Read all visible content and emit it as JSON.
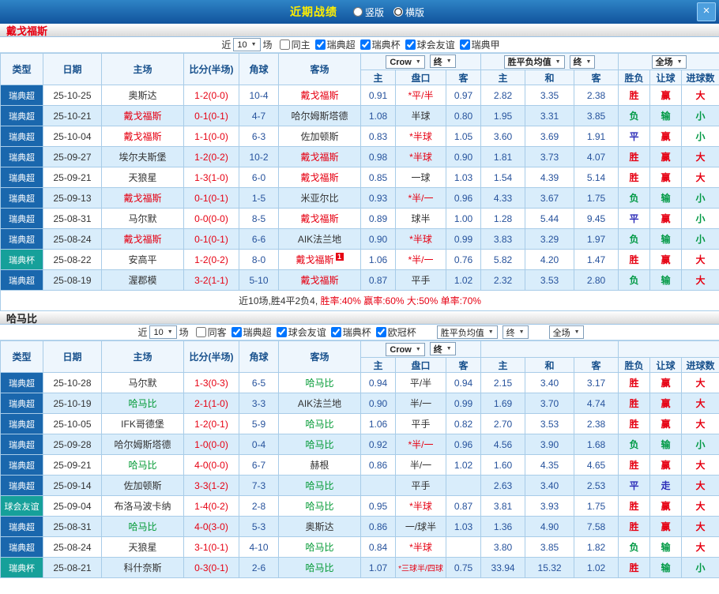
{
  "topbar": {
    "title": "近期战绩",
    "layout_options": [
      {
        "label": "竖版",
        "selected": false
      },
      {
        "label": "横版",
        "selected": true
      }
    ],
    "close_label": "×"
  },
  "columns": {
    "main": [
      "类型",
      "日期",
      "主场",
      "比分(半场)",
      "角球",
      "客场"
    ],
    "sub": [
      "主",
      "盘口",
      "客",
      "主",
      "和",
      "客",
      "胜负",
      "让球",
      "进球数"
    ]
  },
  "result_colors": {
    "胜": "#e60012",
    "负": "#009944",
    "平": "#2d2db8",
    "赢": "#e60012",
    "输": "#009944",
    "走": "#2d2db8",
    "大": "#e60012",
    "小": "#009944"
  },
  "league_colors": {
    "瑞典超": "#1a67ad",
    "瑞典杯": "#16a09a",
    "球会友谊": "#16a09a",
    "瑞典甲": "#1a67ad",
    "欧冠杯": "#16a09a"
  },
  "sections": [
    {
      "team": "戴戈福斯",
      "team_color": "#e60012",
      "highlight_color": "#e60012",
      "filter": {
        "near_label": "近",
        "near_value": "10",
        "games_label": "场",
        "same_label": "同主",
        "same_checked": false,
        "leagues": [
          {
            "label": "瑞典超",
            "checked": true
          },
          {
            "label": "瑞典杯",
            "checked": true
          },
          {
            "label": "球会友谊",
            "checked": true
          },
          {
            "label": "瑞典甲",
            "checked": true
          }
        ],
        "dropdowns": []
      },
      "header_dropdowns": {
        "group1": [
          "Crow",
          "终"
        ],
        "group2": [
          "胜平负均值",
          "终"
        ],
        "group3": [
          "全场"
        ]
      },
      "rows": [
        {
          "type": "瑞典超",
          "date": "25-10-25",
          "home": "奥斯达",
          "home_hl": false,
          "score": "1-2(0-0)",
          "corner": "10-4",
          "away": "戴戈福斯",
          "away_hl": true,
          "away_badge": "",
          "h_odds": "0.91",
          "handicap": "*平/半",
          "a_odds": "0.97",
          "e_home": "2.82",
          "e_draw": "3.35",
          "e_away": "2.38",
          "res": "胜",
          "hres": "赢",
          "gres": "大"
        },
        {
          "type": "瑞典超",
          "date": "25-10-21",
          "home": "戴戈福斯",
          "home_hl": true,
          "score": "0-1(0-1)",
          "corner": "4-7",
          "away": "哈尔姆斯塔德",
          "away_hl": false,
          "away_badge": "",
          "h_odds": "1.08",
          "handicap": "半球",
          "a_odds": "0.80",
          "e_home": "1.95",
          "e_draw": "3.31",
          "e_away": "3.85",
          "res": "负",
          "hres": "输",
          "gres": "小"
        },
        {
          "type": "瑞典超",
          "date": "25-10-04",
          "home": "戴戈福斯",
          "home_hl": true,
          "score": "1-1(0-0)",
          "corner": "6-3",
          "away": "佐加顿斯",
          "away_hl": false,
          "away_badge": "",
          "h_odds": "0.83",
          "handicap": "*半球",
          "a_odds": "1.05",
          "e_home": "3.60",
          "e_draw": "3.69",
          "e_away": "1.91",
          "res": "平",
          "hres": "赢",
          "gres": "小"
        },
        {
          "type": "瑞典超",
          "date": "25-09-27",
          "home": "埃尔夫斯堡",
          "home_hl": false,
          "score": "1-2(0-2)",
          "corner": "10-2",
          "away": "戴戈福斯",
          "away_hl": true,
          "away_badge": "",
          "h_odds": "0.98",
          "handicap": "*半球",
          "a_odds": "0.90",
          "e_home": "1.81",
          "e_draw": "3.73",
          "e_away": "4.07",
          "res": "胜",
          "hres": "赢",
          "gres": "大"
        },
        {
          "type": "瑞典超",
          "date": "25-09-21",
          "home": "天狼星",
          "home_hl": false,
          "score": "1-3(1-0)",
          "corner": "6-0",
          "away": "戴戈福斯",
          "away_hl": true,
          "away_badge": "",
          "h_odds": "0.85",
          "handicap": "一球",
          "a_odds": "1.03",
          "e_home": "1.54",
          "e_draw": "4.39",
          "e_away": "5.14",
          "res": "胜",
          "hres": "赢",
          "gres": "大"
        },
        {
          "type": "瑞典超",
          "date": "25-09-13",
          "home": "戴戈福斯",
          "home_hl": true,
          "score": "0-1(0-1)",
          "corner": "1-5",
          "away": "米亚尔比",
          "away_hl": false,
          "away_badge": "",
          "h_odds": "0.93",
          "handicap": "*半/一",
          "a_odds": "0.96",
          "e_home": "4.33",
          "e_draw": "3.67",
          "e_away": "1.75",
          "res": "负",
          "hres": "输",
          "gres": "小"
        },
        {
          "type": "瑞典超",
          "date": "25-08-31",
          "home": "马尔默",
          "home_hl": false,
          "score": "0-0(0-0)",
          "corner": "8-5",
          "away": "戴戈福斯",
          "away_hl": true,
          "away_badge": "",
          "h_odds": "0.89",
          "handicap": "球半",
          "a_odds": "1.00",
          "e_home": "1.28",
          "e_draw": "5.44",
          "e_away": "9.45",
          "res": "平",
          "hres": "赢",
          "gres": "小"
        },
        {
          "type": "瑞典超",
          "date": "25-08-24",
          "home": "戴戈福斯",
          "home_hl": true,
          "score": "0-1(0-1)",
          "corner": "6-6",
          "away": "AIK法兰地",
          "away_hl": false,
          "away_badge": "",
          "h_odds": "0.90",
          "handicap": "*半球",
          "a_odds": "0.99",
          "e_home": "3.83",
          "e_draw": "3.29",
          "e_away": "1.97",
          "res": "负",
          "hres": "输",
          "gres": "小"
        },
        {
          "type": "瑞典杯",
          "date": "25-08-22",
          "home": "安高平",
          "home_hl": false,
          "score": "1-2(0-2)",
          "corner": "8-0",
          "away": "戴戈福斯",
          "away_hl": true,
          "away_badge": "1",
          "h_odds": "1.06",
          "handicap": "*半/一",
          "a_odds": "0.76",
          "e_home": "5.82",
          "e_draw": "4.20",
          "e_away": "1.47",
          "res": "胜",
          "hres": "赢",
          "gres": "大"
        },
        {
          "type": "瑞典超",
          "date": "25-08-19",
          "home": "渥郡模",
          "home_hl": false,
          "score": "3-2(1-1)",
          "corner": "5-10",
          "away": "戴戈福斯",
          "away_hl": true,
          "away_badge": "",
          "h_odds": "0.87",
          "handicap": "平手",
          "a_odds": "1.02",
          "e_home": "2.32",
          "e_draw": "3.53",
          "e_away": "2.80",
          "res": "负",
          "hres": "输",
          "gres": "大"
        }
      ],
      "summary": [
        {
          "text": "近10场,胜4平2负4, ",
          "color": "#333333"
        },
        {
          "text": "胜率:40% ",
          "color": "#e60012"
        },
        {
          "text": "赢率:60% ",
          "color": "#e60012"
        },
        {
          "text": "大:50% ",
          "color": "#e60012"
        },
        {
          "text": "单率:70%",
          "color": "#e60012"
        }
      ]
    },
    {
      "team": "哈马比",
      "team_color": "#222222",
      "highlight_color": "#009933",
      "filter": {
        "near_label": "近",
        "near_value": "10",
        "games_label": "场",
        "same_label": "同客",
        "same_checked": false,
        "leagues": [
          {
            "label": "瑞典超",
            "checked": true
          },
          {
            "label": "球会友谊",
            "checked": true
          },
          {
            "label": "瑞典杯",
            "checked": true
          },
          {
            "label": "欧冠杯",
            "checked": true
          }
        ],
        "dropdowns": [
          [
            "胜平负均值",
            "终"
          ],
          [
            "全场"
          ]
        ]
      },
      "header_dropdowns": {
        "group1": [
          "Crow",
          "终"
        ],
        "group2": null,
        "group3": null
      },
      "rows": [
        {
          "type": "瑞典超",
          "date": "25-10-28",
          "home": "马尔默",
          "home_hl": false,
          "score": "1-3(0-3)",
          "corner": "6-5",
          "away": "哈马比",
          "away_hl": true,
          "away_badge": "",
          "h_odds": "0.94",
          "handicap": "平/半",
          "a_odds": "0.94",
          "e_home": "2.15",
          "e_draw": "3.40",
          "e_away": "3.17",
          "res": "胜",
          "hres": "赢",
          "gres": "大"
        },
        {
          "type": "瑞典超",
          "date": "25-10-19",
          "home": "哈马比",
          "home_hl": true,
          "score": "2-1(1-0)",
          "corner": "3-3",
          "away": "AIK法兰地",
          "away_hl": false,
          "away_badge": "",
          "h_odds": "0.90",
          "handicap": "半/一",
          "a_odds": "0.99",
          "e_home": "1.69",
          "e_draw": "3.70",
          "e_away": "4.74",
          "res": "胜",
          "hres": "赢",
          "gres": "大"
        },
        {
          "type": "瑞典超",
          "date": "25-10-05",
          "home": "IFK哥德堡",
          "home_hl": false,
          "score": "1-2(0-1)",
          "corner": "5-9",
          "away": "哈马比",
          "away_hl": true,
          "away_badge": "",
          "h_odds": "1.06",
          "handicap": "平手",
          "a_odds": "0.82",
          "e_home": "2.70",
          "e_draw": "3.53",
          "e_away": "2.38",
          "res": "胜",
          "hres": "赢",
          "gres": "大"
        },
        {
          "type": "瑞典超",
          "date": "25-09-28",
          "home": "哈尔姆斯塔德",
          "home_hl": false,
          "score": "1-0(0-0)",
          "corner": "0-4",
          "away": "哈马比",
          "away_hl": true,
          "away_badge": "",
          "h_odds": "0.92",
          "handicap": "*半/一",
          "a_odds": "0.96",
          "e_home": "4.56",
          "e_draw": "3.90",
          "e_away": "1.68",
          "res": "负",
          "hres": "输",
          "gres": "小"
        },
        {
          "type": "瑞典超",
          "date": "25-09-21",
          "home": "哈马比",
          "home_hl": true,
          "score": "4-0(0-0)",
          "corner": "6-7",
          "away": "赫根",
          "away_hl": false,
          "away_badge": "",
          "h_odds": "0.86",
          "handicap": "半/一",
          "a_odds": "1.02",
          "e_home": "1.60",
          "e_draw": "4.35",
          "e_away": "4.65",
          "res": "胜",
          "hres": "赢",
          "gres": "大"
        },
        {
          "type": "瑞典超",
          "date": "25-09-14",
          "home": "佐加顿斯",
          "home_hl": false,
          "score": "3-3(1-2)",
          "corner": "7-3",
          "away": "哈马比",
          "away_hl": true,
          "away_badge": "",
          "h_odds": "",
          "handicap": "平手",
          "a_odds": "",
          "e_home": "2.63",
          "e_draw": "3.40",
          "e_away": "2.53",
          "res": "平",
          "hres": "走",
          "gres": "大"
        },
        {
          "type": "球会友谊",
          "date": "25-09-04",
          "home": "布洛马波卡纳",
          "home_hl": false,
          "score": "1-4(0-2)",
          "corner": "2-8",
          "away": "哈马比",
          "away_hl": true,
          "away_badge": "",
          "h_odds": "0.95",
          "handicap": "*半球",
          "a_odds": "0.87",
          "e_home": "3.81",
          "e_draw": "3.93",
          "e_away": "1.75",
          "res": "胜",
          "hres": "赢",
          "gres": "大"
        },
        {
          "type": "瑞典超",
          "date": "25-08-31",
          "home": "哈马比",
          "home_hl": true,
          "score": "4-0(3-0)",
          "corner": "5-3",
          "away": "奥斯达",
          "away_hl": false,
          "away_badge": "",
          "h_odds": "0.86",
          "handicap": "一/球半",
          "a_odds": "1.03",
          "e_home": "1.36",
          "e_draw": "4.90",
          "e_away": "7.58",
          "res": "胜",
          "hres": "赢",
          "gres": "大"
        },
        {
          "type": "瑞典超",
          "date": "25-08-24",
          "home": "天狼星",
          "home_hl": false,
          "score": "3-1(0-1)",
          "corner": "4-10",
          "away": "哈马比",
          "away_hl": true,
          "away_badge": "",
          "h_odds": "0.84",
          "handicap": "*半球",
          "a_odds": "",
          "e_home": "3.80",
          "e_draw": "3.85",
          "e_away": "1.82",
          "res": "负",
          "hres": "输",
          "gres": "大"
        },
        {
          "type": "瑞典杯",
          "date": "25-08-21",
          "home": "科什奈斯",
          "home_hl": false,
          "score": "0-3(0-1)",
          "corner": "2-6",
          "away": "哈马比",
          "away_hl": true,
          "away_badge": "",
          "h_odds": "1.07",
          "handicap": "*三球半/四球",
          "a_odds": "0.75",
          "e_home": "33.94",
          "e_draw": "15.32",
          "e_away": "1.02",
          "res": "胜",
          "hres": "输",
          "gres": "小"
        }
      ],
      "summary": null
    }
  ]
}
